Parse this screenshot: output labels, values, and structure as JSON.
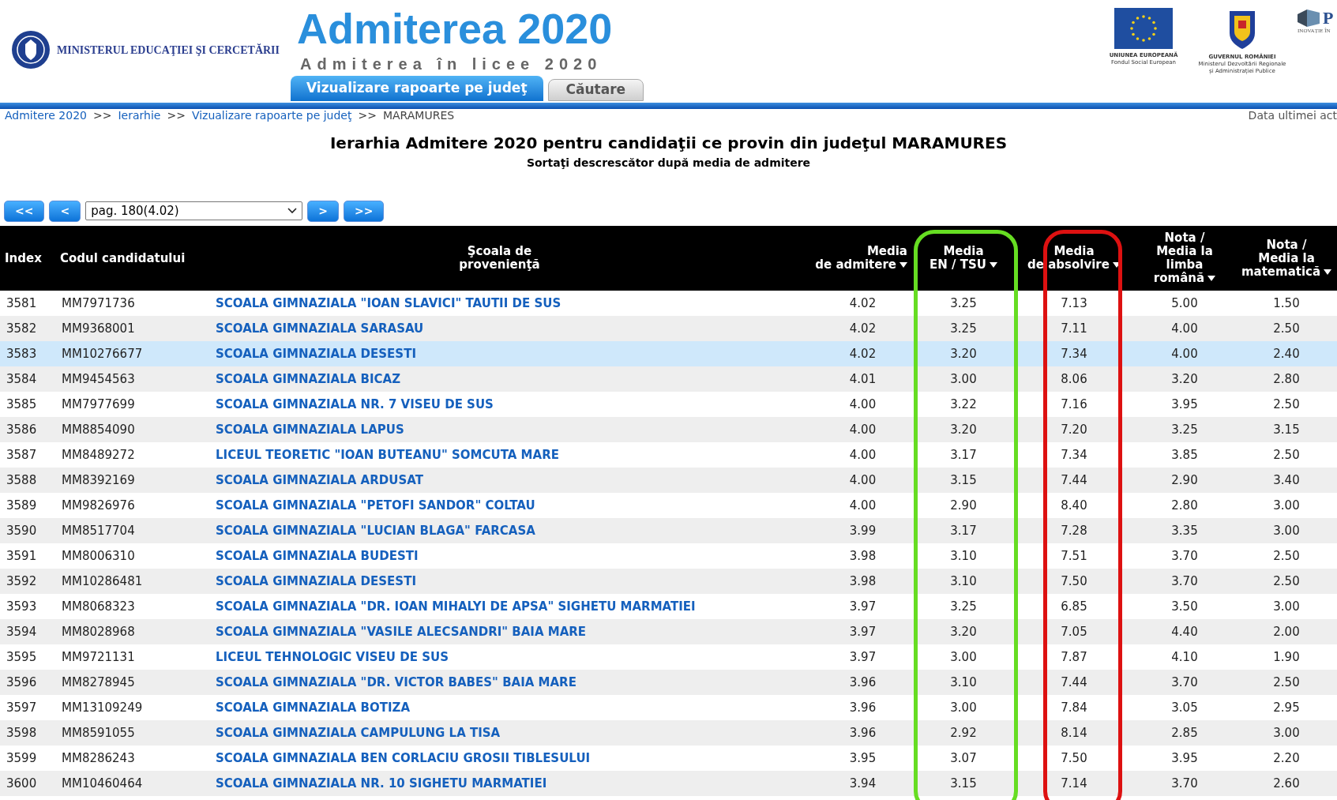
{
  "header": {
    "ministry": "MINISTERUL EDUCAŢIEI ŞI CERCETĂRII",
    "title": "Admiterea 2020",
    "subtitle": "Admiterea în licee 2020",
    "logos": [
      {
        "kind": "eu",
        "lines": [
          "UNIUNEA EUROPEANĂ",
          "Fondul Social European"
        ]
      },
      {
        "kind": "crest",
        "lines": [
          "GUVERNUL ROMÂNIEI",
          "Ministerul Dezvoltării Regionale",
          "și Administrației Publice"
        ]
      },
      {
        "kind": "brand",
        "lines": [
          "P",
          "INOVAȚIE ÎN"
        ]
      }
    ]
  },
  "tabs": [
    {
      "label": "Vizualizare rapoarte pe judeţ",
      "selected": true
    },
    {
      "label": "Căutare",
      "selected": false
    }
  ],
  "breadcrumb": [
    {
      "label": "Admitere 2020",
      "link": true
    },
    {
      "label": "Ierarhie",
      "link": true
    },
    {
      "label": "Vizualizare rapoarte pe judeţ",
      "link": true
    },
    {
      "label": "MARAMURES",
      "link": false
    }
  ],
  "breadcrumb_separator": ">>",
  "last_update": "Data ultimei act",
  "page_title": "Ierarhia Admitere 2020 pentru candidaţii ce provin din judeţul MARAMURES",
  "page_subtitle": "Sortaţi descrescător după media de admitere",
  "pagination": {
    "first": "<<",
    "prev": "<",
    "page": "pag. 180(4.02)",
    "next": ">",
    "last": ">>"
  },
  "table": {
    "columns": [
      {
        "lines": [
          "Index"
        ],
        "sortable": false
      },
      {
        "lines": [
          "Codul candidatului"
        ],
        "sortable": false
      },
      {
        "lines": [
          "Şcoala de",
          "provenienţă"
        ],
        "sortable": false
      },
      {
        "lines": [
          "Media",
          "de admitere"
        ],
        "sortable": true
      },
      {
        "lines": [
          "Media",
          "EN / TSU"
        ],
        "sortable": true,
        "color": "#66dd22"
      },
      {
        "lines": [
          "Media",
          "de absolvire"
        ],
        "sortable": true,
        "color": "#dd1111"
      },
      {
        "lines": [
          "Nota /",
          "Media la",
          "limba",
          "română"
        ],
        "sortable": true
      },
      {
        "lines": [
          "Nota /",
          "Media la",
          "matematică"
        ],
        "sortable": true
      }
    ],
    "rows": [
      {
        "selected": false,
        "cells": [
          "3581",
          "MM7971736",
          "SCOALA GIMNAZIALA \"IOAN SLAVICI\" TAUTII DE SUS",
          "4.02",
          "3.25",
          "7.13",
          "5.00",
          "1.50"
        ]
      },
      {
        "selected": false,
        "cells": [
          "3582",
          "MM9368001",
          "SCOALA GIMNAZIALA SARASAU",
          "4.02",
          "3.25",
          "7.11",
          "4.00",
          "2.50"
        ]
      },
      {
        "selected": true,
        "cells": [
          "3583",
          "MM10276677",
          "SCOALA GIMNAZIALA DESESTI",
          "4.02",
          "3.20",
          "7.34",
          "4.00",
          "2.40"
        ]
      },
      {
        "selected": false,
        "cells": [
          "3584",
          "MM9454563",
          "SCOALA GIMNAZIALA BICAZ",
          "4.01",
          "3.00",
          "8.06",
          "3.20",
          "2.80"
        ]
      },
      {
        "selected": false,
        "cells": [
          "3585",
          "MM7977699",
          "SCOALA GIMNAZIALA NR. 7 VISEU DE SUS",
          "4.00",
          "3.22",
          "7.16",
          "3.95",
          "2.50"
        ]
      },
      {
        "selected": false,
        "cells": [
          "3586",
          "MM8854090",
          "SCOALA GIMNAZIALA LAPUS",
          "4.00",
          "3.20",
          "7.20",
          "3.25",
          "3.15"
        ]
      },
      {
        "selected": false,
        "cells": [
          "3587",
          "MM8489272",
          "LICEUL TEORETIC \"IOAN BUTEANU\" SOMCUTA MARE",
          "4.00",
          "3.17",
          "7.34",
          "3.85",
          "2.50"
        ]
      },
      {
        "selected": false,
        "cells": [
          "3588",
          "MM8392169",
          "SCOALA GIMNAZIALA ARDUSAT",
          "4.00",
          "3.15",
          "7.44",
          "2.90",
          "3.40"
        ]
      },
      {
        "selected": false,
        "cells": [
          "3589",
          "MM9826976",
          "SCOALA GIMNAZIALA \"PETOFI SANDOR\" COLTAU",
          "4.00",
          "2.90",
          "8.40",
          "2.80",
          "3.00"
        ]
      },
      {
        "selected": false,
        "cells": [
          "3590",
          "MM8517704",
          "SCOALA GIMNAZIALA \"LUCIAN BLAGA\" FARCASA",
          "3.99",
          "3.17",
          "7.28",
          "3.35",
          "3.00"
        ]
      },
      {
        "selected": false,
        "cells": [
          "3591",
          "MM8006310",
          "SCOALA GIMNAZIALA BUDESTI",
          "3.98",
          "3.10",
          "7.51",
          "3.70",
          "2.50"
        ]
      },
      {
        "selected": false,
        "cells": [
          "3592",
          "MM10286481",
          "SCOALA GIMNAZIALA DESESTI",
          "3.98",
          "3.10",
          "7.50",
          "3.70",
          "2.50"
        ]
      },
      {
        "selected": false,
        "cells": [
          "3593",
          "MM8068323",
          "SCOALA GIMNAZIALA \"DR. IOAN MIHALYI DE APSA\" SIGHETU MARMATIEI",
          "3.97",
          "3.25",
          "6.85",
          "3.50",
          "3.00"
        ]
      },
      {
        "selected": false,
        "cells": [
          "3594",
          "MM8028968",
          "SCOALA GIMNAZIALA \"VASILE ALECSANDRI\" BAIA MARE",
          "3.97",
          "3.20",
          "7.05",
          "4.40",
          "2.00"
        ]
      },
      {
        "selected": false,
        "cells": [
          "3595",
          "MM9721131",
          "LICEUL TEHNOLOGIC VISEU DE SUS",
          "3.97",
          "3.00",
          "7.87",
          "4.10",
          "1.90"
        ]
      },
      {
        "selected": false,
        "cells": [
          "3596",
          "MM8278945",
          "SCOALA GIMNAZIALA \"DR. VICTOR BABES\" BAIA MARE",
          "3.96",
          "3.10",
          "7.44",
          "3.70",
          "2.50"
        ]
      },
      {
        "selected": false,
        "cells": [
          "3597",
          "MM13109249",
          "SCOALA GIMNAZIALA BOTIZA",
          "3.96",
          "3.00",
          "7.84",
          "3.05",
          "2.95"
        ]
      },
      {
        "selected": false,
        "cells": [
          "3598",
          "MM8591055",
          "SCOALA GIMNAZIALA CAMPULUNG LA TISA",
          "3.96",
          "2.92",
          "8.14",
          "2.85",
          "3.00"
        ]
      },
      {
        "selected": false,
        "cells": [
          "3599",
          "MM8286243",
          "SCOALA GIMNAZIALA BEN CORLACIU GROSII TIBLESULUI",
          "3.95",
          "3.07",
          "7.50",
          "3.95",
          "2.20"
        ]
      },
      {
        "selected": false,
        "cells": [
          "3600",
          "MM10460464",
          "SCOALA GIMNAZIALA NR. 10 SIGHETU MARMATIEI",
          "3.94",
          "3.15",
          "7.14",
          "3.70",
          "2.60"
        ]
      }
    ]
  }
}
